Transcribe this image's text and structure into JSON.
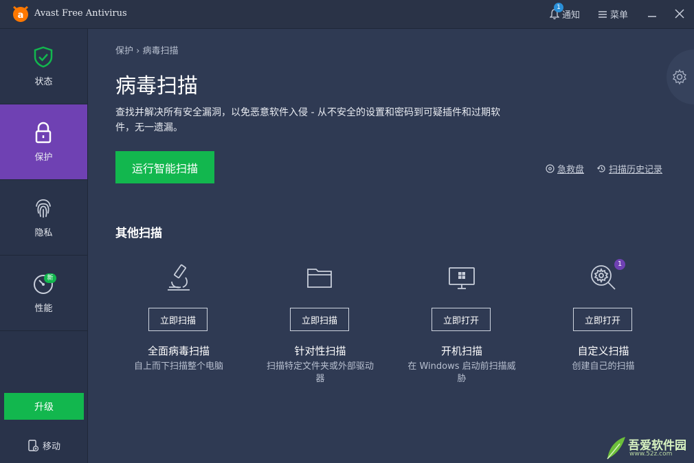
{
  "app": {
    "title": "Avast Free Antivirus",
    "logo_icon": "avast-logo",
    "accent": "#ff7800"
  },
  "titlebar": {
    "notifications_label": "通知",
    "notifications_count": "1",
    "menu_label": "菜单"
  },
  "sidebar": {
    "items": [
      {
        "label": "状态",
        "icon": "shield-check-icon"
      },
      {
        "label": "保护",
        "icon": "lock-icon"
      },
      {
        "label": "隐私",
        "icon": "fingerprint-icon"
      },
      {
        "label": "性能",
        "icon": "speedometer-icon",
        "badge": "新"
      }
    ],
    "upgrade_label": "升级",
    "mobile_label": "移动"
  },
  "main": {
    "breadcrumb": {
      "parent": "保护",
      "separator": "›",
      "current": "病毒扫描"
    },
    "title": "病毒扫描",
    "description": "查找并解决所有安全漏洞，以免恶意软件入侵 - 从不安全的设置和密码到可疑插件和过期软件，无一遗漏。",
    "smart_scan_label": "运行智能扫描",
    "rescue_disk_label": "急救盘",
    "scan_history_label": "扫描历史记录",
    "other_scans_title": "其他扫描",
    "scans": [
      {
        "icon": "microscope-icon",
        "button": "立即扫描",
        "name": "全面病毒扫描",
        "desc": "自上而下扫描整个电脑"
      },
      {
        "icon": "folder-icon",
        "button": "立即扫描",
        "name": "针对性扫描",
        "desc": "扫描特定文件夹或外部驱动器"
      },
      {
        "icon": "monitor-windows-icon",
        "button": "立即打开",
        "name": "开机扫描",
        "desc": "在 Windows 启动前扫描威胁"
      },
      {
        "icon": "gear-search-icon",
        "button": "立即打开",
        "name": "自定义扫描",
        "desc": "创建自己的扫描",
        "badge": "1"
      }
    ]
  },
  "watermark": {
    "text": "吾爱软件园",
    "url": "www.52z.com"
  },
  "colors": {
    "background": "#2f3a53",
    "sidebar": "#29334a",
    "active": "#6f41b3",
    "green": "#12b74e"
  }
}
